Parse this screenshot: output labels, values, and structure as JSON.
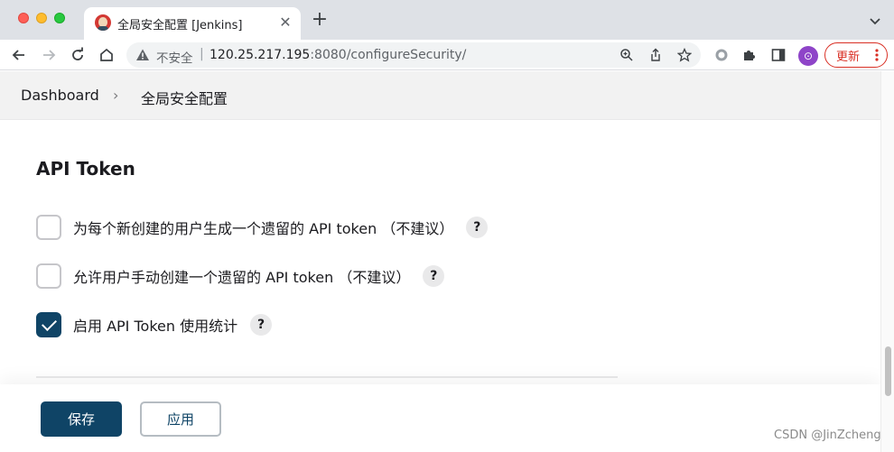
{
  "browser": {
    "tab": {
      "title": "全局安全配置 [Jenkins]",
      "favicon": "jenkins-butler-icon"
    },
    "address": {
      "insecure_label": "不安全",
      "separator": "|",
      "host": "120.25.217.195",
      "path": ":8080/configureSecurity/"
    },
    "update_label": "更新",
    "avatar_glyph": "⊙"
  },
  "breadcrumbs": {
    "items": [
      {
        "label": "Dashboard"
      },
      {
        "label": "全局安全配置"
      }
    ],
    "separator": "›"
  },
  "section": {
    "title": "API Token",
    "options": [
      {
        "label": "为每个新创建的用户生成一个遗留的 API token （不建议）",
        "checked": false,
        "help": "?"
      },
      {
        "label": "允许用户手动创建一个遗留的 API token （不建议）",
        "checked": false,
        "help": "?"
      },
      {
        "label": "启用 API Token 使用统计",
        "checked": true,
        "help": "?"
      }
    ]
  },
  "actions": {
    "save_label": "保存",
    "apply_label": "应用"
  },
  "watermark": "CSDN @JinZcheng",
  "colors": {
    "primary": "#0f4466",
    "breadcrumb_bg": "#f2f2f2",
    "update_red": "#d93025"
  }
}
